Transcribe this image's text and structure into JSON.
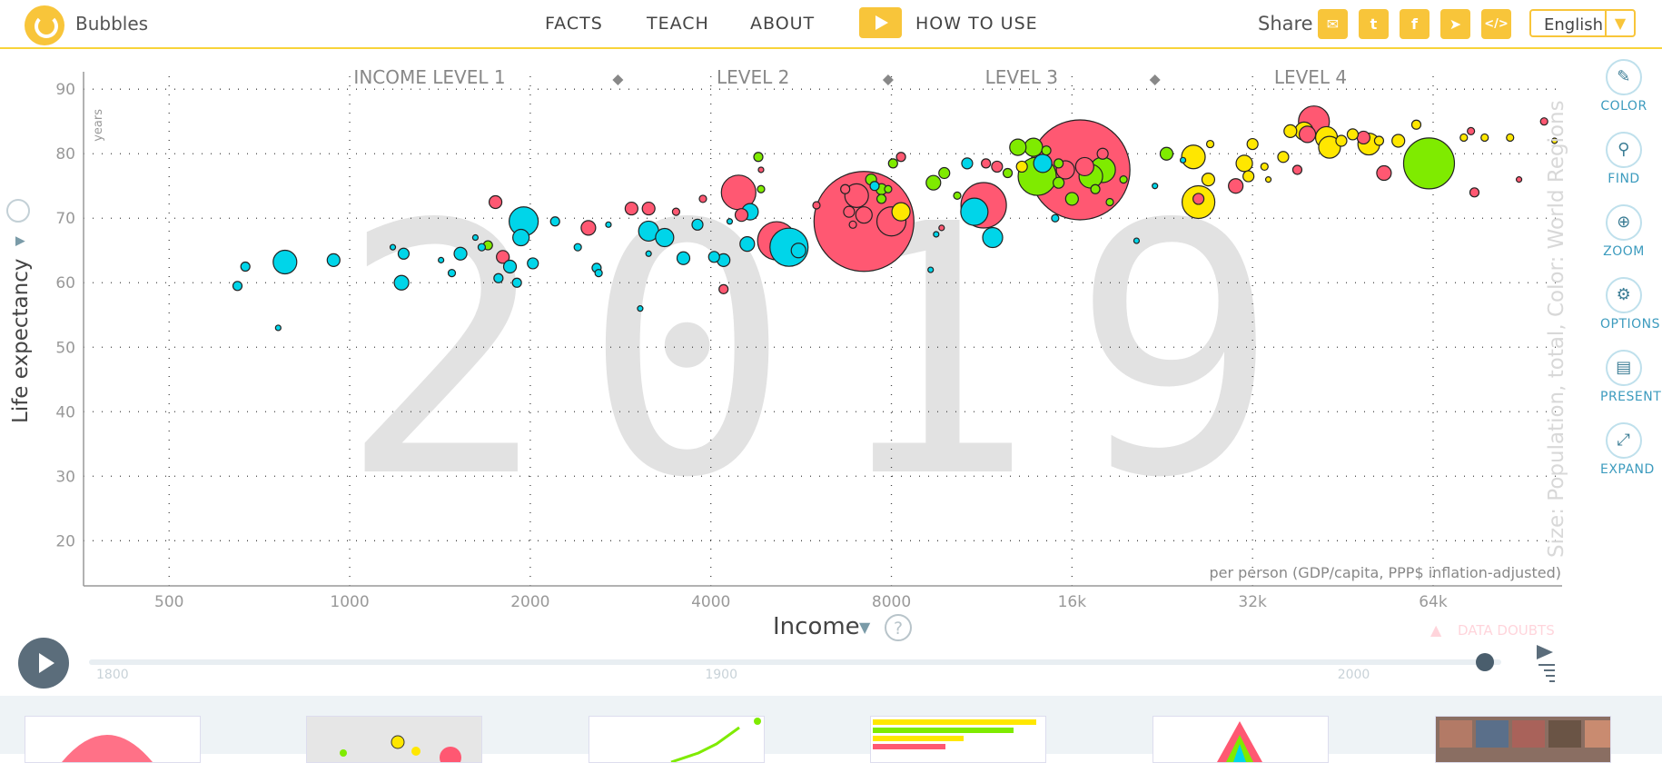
{
  "app": {
    "title": "Bubbles"
  },
  "nav": {
    "facts": "FACTS",
    "teach": "TEACH",
    "about": "ABOUT",
    "how_to_use": "HOW TO USE"
  },
  "share": {
    "label": "Share",
    "icons": [
      "email-icon",
      "twitter-icon",
      "facebook-icon",
      "telegram-icon",
      "embed-icon"
    ]
  },
  "language": {
    "selected": "English"
  },
  "toolbar": {
    "color": "COLOR",
    "find": "FIND",
    "zoom": "ZOOM",
    "options": "OPTIONS",
    "present": "PRESENT",
    "expand": "EXPAND"
  },
  "timeline": {
    "labels": [
      "1800",
      "1900",
      "2000"
    ],
    "range": [
      1800,
      2019
    ],
    "current": 2019
  },
  "data_doubts": "DATA DOUBTS",
  "thumbnails": [
    "thumb-distribution",
    "thumb-map",
    "thumb-lines",
    "thumb-bars",
    "thumb-mountains",
    "thumb-photos"
  ],
  "colors": {
    "asia": "#ff5872",
    "africa": "#00d5e9",
    "americas": "#7feb00",
    "europe": "#ffe700",
    "accent": "#f8c53a"
  },
  "chart_data": {
    "type": "scatter",
    "year_watermark": "2019",
    "xlabel": "Income",
    "xunit": "per person (GDP/capita, PPP$ inflation-adjusted)",
    "ylabel": "Life expectancy",
    "yunit": "years",
    "size_label": "Size: Population, total, Color: World Regions",
    "x_scale": "log",
    "xlim": [
      360,
      105000
    ],
    "ylim": [
      13,
      92
    ],
    "xticks": [
      500,
      1000,
      2000,
      4000,
      8000,
      16000,
      32000,
      64000
    ],
    "xtick_labels": [
      "500",
      "1000",
      "2000",
      "4000",
      "8000",
      "16k",
      "32k",
      "64k"
    ],
    "yticks": [
      20,
      30,
      40,
      50,
      60,
      70,
      80,
      90
    ],
    "ytick_labels": [
      "20",
      "30",
      "40",
      "50",
      "60",
      "70",
      "80",
      "90"
    ],
    "grid": true,
    "income_levels": [
      "INCOME LEVEL 1",
      "LEVEL 2",
      "LEVEL 3",
      "LEVEL 4"
    ],
    "level_boundaries": [
      2800,
      7900,
      22000
    ],
    "points": [
      {
        "x": 650,
        "y": 59.5,
        "r": 5,
        "c": "africa"
      },
      {
        "x": 670,
        "y": 62.5,
        "r": 5,
        "c": "africa"
      },
      {
        "x": 780,
        "y": 63.2,
        "r": 13,
        "c": "africa"
      },
      {
        "x": 760,
        "y": 53,
        "r": 3,
        "c": "africa"
      },
      {
        "x": 940,
        "y": 63.5,
        "r": 7,
        "c": "africa"
      },
      {
        "x": 1180,
        "y": 65.5,
        "r": 3,
        "c": "africa"
      },
      {
        "x": 1230,
        "y": 64.5,
        "r": 6,
        "c": "africa"
      },
      {
        "x": 1220,
        "y": 60,
        "r": 8,
        "c": "africa"
      },
      {
        "x": 1420,
        "y": 63.5,
        "r": 3,
        "c": "africa"
      },
      {
        "x": 1480,
        "y": 61.5,
        "r": 4,
        "c": "africa"
      },
      {
        "x": 1530,
        "y": 64.5,
        "r": 7,
        "c": "africa"
      },
      {
        "x": 1620,
        "y": 67,
        "r": 3,
        "c": "africa"
      },
      {
        "x": 1660,
        "y": 65.5,
        "r": 4,
        "c": "africa"
      },
      {
        "x": 1700,
        "y": 65.8,
        "r": 5,
        "c": "americas"
      },
      {
        "x": 1750,
        "y": 72.5,
        "r": 7,
        "c": "asia"
      },
      {
        "x": 1770,
        "y": 60.7,
        "r": 5,
        "c": "africa"
      },
      {
        "x": 1800,
        "y": 64,
        "r": 7,
        "c": "asia"
      },
      {
        "x": 1850,
        "y": 62.5,
        "r": 7,
        "c": "africa"
      },
      {
        "x": 1900,
        "y": 60,
        "r": 5,
        "c": "africa"
      },
      {
        "x": 1950,
        "y": 69.5,
        "r": 16,
        "c": "africa"
      },
      {
        "x": 1930,
        "y": 67,
        "r": 9,
        "c": "africa"
      },
      {
        "x": 2020,
        "y": 63,
        "r": 6,
        "c": "africa"
      },
      {
        "x": 2200,
        "y": 69.5,
        "r": 5,
        "c": "africa"
      },
      {
        "x": 2400,
        "y": 65.5,
        "r": 4,
        "c": "africa"
      },
      {
        "x": 2500,
        "y": 68.5,
        "r": 8,
        "c": "asia"
      },
      {
        "x": 2580,
        "y": 62.3,
        "r": 5,
        "c": "africa"
      },
      {
        "x": 2600,
        "y": 61.5,
        "r": 4,
        "c": "africa"
      },
      {
        "x": 2700,
        "y": 69,
        "r": 3,
        "c": "africa"
      },
      {
        "x": 2950,
        "y": 71.5,
        "r": 7,
        "c": "asia"
      },
      {
        "x": 3050,
        "y": 56,
        "r": 3,
        "c": "africa"
      },
      {
        "x": 3150,
        "y": 68,
        "r": 11,
        "c": "africa"
      },
      {
        "x": 3350,
        "y": 67,
        "r": 10,
        "c": "africa"
      },
      {
        "x": 3150,
        "y": 71.5,
        "r": 7,
        "c": "asia"
      },
      {
        "x": 3150,
        "y": 64.5,
        "r": 3,
        "c": "africa"
      },
      {
        "x": 3500,
        "y": 71,
        "r": 4,
        "c": "asia"
      },
      {
        "x": 3600,
        "y": 63.8,
        "r": 7,
        "c": "africa"
      },
      {
        "x": 3800,
        "y": 69,
        "r": 6,
        "c": "africa"
      },
      {
        "x": 3880,
        "y": 73,
        "r": 4,
        "c": "asia"
      },
      {
        "x": 4050,
        "y": 64,
        "r": 6,
        "c": "africa"
      },
      {
        "x": 4200,
        "y": 63.5,
        "r": 7,
        "c": "africa"
      },
      {
        "x": 4200,
        "y": 59,
        "r": 5,
        "c": "asia"
      },
      {
        "x": 4300,
        "y": 69.5,
        "r": 3,
        "c": "africa"
      },
      {
        "x": 4450,
        "y": 74,
        "r": 19,
        "c": "asia"
      },
      {
        "x": 4500,
        "y": 70.5,
        "r": 7,
        "c": "asia"
      },
      {
        "x": 4650,
        "y": 71,
        "r": 9,
        "c": "africa"
      },
      {
        "x": 4600,
        "y": 66,
        "r": 8,
        "c": "africa"
      },
      {
        "x": 4800,
        "y": 79.5,
        "r": 5,
        "c": "americas"
      },
      {
        "x": 4850,
        "y": 77.5,
        "r": 3,
        "c": "asia"
      },
      {
        "x": 4850,
        "y": 74.5,
        "r": 4,
        "c": "americas"
      },
      {
        "x": 5150,
        "y": 66.5,
        "r": 21,
        "c": "asia"
      },
      {
        "x": 5400,
        "y": 65.5,
        "r": 21,
        "c": "africa"
      },
      {
        "x": 5600,
        "y": 65,
        "r": 8,
        "c": "africa"
      },
      {
        "x": 6000,
        "y": 72,
        "r": 4,
        "c": "asia"
      },
      {
        "x": 6700,
        "y": 74.5,
        "r": 5,
        "c": "asia"
      },
      {
        "x": 7200,
        "y": 69.5,
        "r": 55,
        "c": "asia"
      },
      {
        "x": 7000,
        "y": 73.5,
        "r": 13,
        "c": "asia"
      },
      {
        "x": 7200,
        "y": 70.5,
        "r": 9,
        "c": "asia"
      },
      {
        "x": 6800,
        "y": 71,
        "r": 6,
        "c": "asia"
      },
      {
        "x": 6900,
        "y": 69,
        "r": 4,
        "c": "asia"
      },
      {
        "x": 7400,
        "y": 76,
        "r": 6,
        "c": "americas"
      },
      {
        "x": 7700,
        "y": 74.5,
        "r": 6,
        "c": "americas"
      },
      {
        "x": 7700,
        "y": 73,
        "r": 5,
        "c": "americas"
      },
      {
        "x": 7900,
        "y": 74.5,
        "r": 4,
        "c": "americas"
      },
      {
        "x": 7500,
        "y": 75,
        "r": 5,
        "c": "africa"
      },
      {
        "x": 8000,
        "y": 69.5,
        "r": 16,
        "c": "asia"
      },
      {
        "x": 8300,
        "y": 71,
        "r": 10,
        "c": "europe"
      },
      {
        "x": 8050,
        "y": 78.5,
        "r": 5,
        "c": "americas"
      },
      {
        "x": 8300,
        "y": 79.5,
        "r": 5,
        "c": "asia"
      },
      {
        "x": 9300,
        "y": 62,
        "r": 3,
        "c": "africa"
      },
      {
        "x": 9400,
        "y": 75.5,
        "r": 8,
        "c": "americas"
      },
      {
        "x": 9500,
        "y": 67.5,
        "r": 3,
        "c": "africa"
      },
      {
        "x": 9800,
        "y": 77,
        "r": 6,
        "c": "americas"
      },
      {
        "x": 9700,
        "y": 68.5,
        "r": 3,
        "c": "asia"
      },
      {
        "x": 10300,
        "y": 73.5,
        "r": 4,
        "c": "americas"
      },
      {
        "x": 10700,
        "y": 78.5,
        "r": 6,
        "c": "africa"
      },
      {
        "x": 11000,
        "y": 71,
        "r": 15,
        "c": "africa"
      },
      {
        "x": 11400,
        "y": 72,
        "r": 25,
        "c": "asia"
      },
      {
        "x": 11500,
        "y": 78.5,
        "r": 5,
        "c": "asia"
      },
      {
        "x": 11800,
        "y": 67,
        "r": 11,
        "c": "africa"
      },
      {
        "x": 12000,
        "y": 78,
        "r": 6,
        "c": "asia"
      },
      {
        "x": 12500,
        "y": 77,
        "r": 5,
        "c": "americas"
      },
      {
        "x": 13000,
        "y": 81,
        "r": 9,
        "c": "americas"
      },
      {
        "x": 13200,
        "y": 78,
        "r": 6,
        "c": "europe"
      },
      {
        "x": 14000,
        "y": 76.5,
        "r": 21,
        "c": "americas"
      },
      {
        "x": 13800,
        "y": 81,
        "r": 10,
        "c": "americas"
      },
      {
        "x": 14300,
        "y": 78.5,
        "r": 10,
        "c": "africa"
      },
      {
        "x": 14500,
        "y": 80.5,
        "r": 5,
        "c": "americas"
      },
      {
        "x": 15200,
        "y": 78.5,
        "r": 5,
        "c": "americas"
      },
      {
        "x": 15200,
        "y": 75.5,
        "r": 6,
        "c": "americas"
      },
      {
        "x": 16500,
        "y": 77.5,
        "r": 55,
        "c": "asia"
      },
      {
        "x": 15600,
        "y": 77.5,
        "r": 10,
        "c": "asia"
      },
      {
        "x": 16800,
        "y": 78,
        "r": 10,
        "c": "asia"
      },
      {
        "x": 17200,
        "y": 76.5,
        "r": 13,
        "c": "americas"
      },
      {
        "x": 18000,
        "y": 77.5,
        "r": 14,
        "c": "americas"
      },
      {
        "x": 17500,
        "y": 74.5,
        "r": 5,
        "c": "americas"
      },
      {
        "x": 16000,
        "y": 73,
        "r": 7,
        "c": "americas"
      },
      {
        "x": 15000,
        "y": 70,
        "r": 4,
        "c": "africa"
      },
      {
        "x": 18500,
        "y": 72.5,
        "r": 4,
        "c": "americas"
      },
      {
        "x": 18000,
        "y": 80,
        "r": 6,
        "c": "asia"
      },
      {
        "x": 19500,
        "y": 76,
        "r": 4,
        "c": "americas"
      },
      {
        "x": 20500,
        "y": 66.5,
        "r": 3,
        "c": "africa"
      },
      {
        "x": 22000,
        "y": 75,
        "r": 3,
        "c": "africa"
      },
      {
        "x": 23000,
        "y": 80,
        "r": 7,
        "c": "americas"
      },
      {
        "x": 24500,
        "y": 79,
        "r": 3,
        "c": "africa"
      },
      {
        "x": 25500,
        "y": 79.5,
        "r": 13,
        "c": "europe"
      },
      {
        "x": 26000,
        "y": 72.5,
        "r": 18,
        "c": "europe"
      },
      {
        "x": 26000,
        "y": 73,
        "r": 6,
        "c": "asia"
      },
      {
        "x": 27000,
        "y": 76,
        "r": 7,
        "c": "europe"
      },
      {
        "x": 27200,
        "y": 81.5,
        "r": 4,
        "c": "europe"
      },
      {
        "x": 30000,
        "y": 75,
        "r": 8,
        "c": "asia"
      },
      {
        "x": 31000,
        "y": 78.5,
        "r": 9,
        "c": "europe"
      },
      {
        "x": 32000,
        "y": 81.5,
        "r": 6,
        "c": "europe"
      },
      {
        "x": 31500,
        "y": 76.5,
        "r": 6,
        "c": "europe"
      },
      {
        "x": 33500,
        "y": 78,
        "r": 4,
        "c": "europe"
      },
      {
        "x": 34000,
        "y": 76,
        "r": 3,
        "c": "europe"
      },
      {
        "x": 36000,
        "y": 79.5,
        "r": 6,
        "c": "europe"
      },
      {
        "x": 37000,
        "y": 83.5,
        "r": 7,
        "c": "europe"
      },
      {
        "x": 38000,
        "y": 77.5,
        "r": 5,
        "c": "asia"
      },
      {
        "x": 39000,
        "y": 83.5,
        "r": 10,
        "c": "europe"
      },
      {
        "x": 40500,
        "y": 85,
        "r": 17,
        "c": "asia"
      },
      {
        "x": 39500,
        "y": 83,
        "r": 9,
        "c": "asia"
      },
      {
        "x": 42500,
        "y": 82.5,
        "r": 12,
        "c": "europe"
      },
      {
        "x": 43000,
        "y": 81,
        "r": 12,
        "c": "europe"
      },
      {
        "x": 45000,
        "y": 82,
        "r": 6,
        "c": "europe"
      },
      {
        "x": 47000,
        "y": 83,
        "r": 6,
        "c": "europe"
      },
      {
        "x": 49000,
        "y": 82.5,
        "r": 7,
        "c": "asia"
      },
      {
        "x": 50000,
        "y": 81.5,
        "r": 12,
        "c": "europe"
      },
      {
        "x": 52000,
        "y": 82,
        "r": 5,
        "c": "europe"
      },
      {
        "x": 53000,
        "y": 77,
        "r": 8,
        "c": "asia"
      },
      {
        "x": 56000,
        "y": 82,
        "r": 7,
        "c": "europe"
      },
      {
        "x": 60000,
        "y": 84.5,
        "r": 5,
        "c": "europe"
      },
      {
        "x": 63000,
        "y": 78.5,
        "r": 28,
        "c": "americas"
      },
      {
        "x": 72000,
        "y": 82.5,
        "r": 4,
        "c": "europe"
      },
      {
        "x": 75000,
        "y": 74,
        "r": 5,
        "c": "asia"
      },
      {
        "x": 74000,
        "y": 83.5,
        "r": 4,
        "c": "asia"
      },
      {
        "x": 78000,
        "y": 82.5,
        "r": 4,
        "c": "europe"
      },
      {
        "x": 86000,
        "y": 82.5,
        "r": 4,
        "c": "europe"
      },
      {
        "x": 89000,
        "y": 76,
        "r": 3,
        "c": "asia"
      },
      {
        "x": 98000,
        "y": 85,
        "r": 4,
        "c": "asia"
      },
      {
        "x": 102000,
        "y": 82,
        "r": 3,
        "c": "europe"
      }
    ]
  }
}
